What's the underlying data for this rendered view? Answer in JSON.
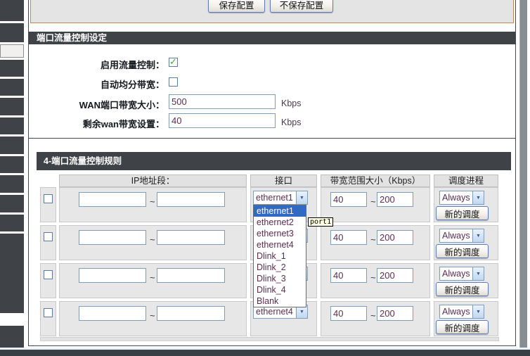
{
  "header": {
    "save_button": "保存配置",
    "discard_button": "不保存配置"
  },
  "settings": {
    "title": "端口流量控制设定",
    "enable_label": "启用流量控制：",
    "auto_split_label": "自动均分带宽：",
    "wan_bandwidth_label": "WAN端口带宽大小：",
    "wan_bandwidth_value": "500",
    "remain_bandwidth_label": "剩余wan带宽设置：",
    "remain_bandwidth_value": "40",
    "unit": "Kbps"
  },
  "rules": {
    "title": "4-端口流量控制规则",
    "col_ip": "IP地址段：",
    "col_iface": "接口",
    "col_bw": "带宽范围大小（Kbps）",
    "col_sched": "调度进程",
    "tilde": "~",
    "new_sched_label": "新的调度",
    "rows": [
      {
        "iface": "ethernet1",
        "bw_min": "40",
        "bw_max": "200",
        "sched": "Always"
      },
      {
        "iface": "",
        "bw_min": "40",
        "bw_max": "200",
        "sched": "Always"
      },
      {
        "iface": "",
        "bw_min": "40",
        "bw_max": "200",
        "sched": "Always"
      },
      {
        "iface": "ethernet4",
        "bw_min": "40",
        "bw_max": "200",
        "sched": "Always"
      }
    ],
    "dropdown_options": [
      "ethernet1",
      "ethernet2",
      "ethernet3",
      "ethernet4",
      "Dlink_1",
      "Dlink_2",
      "Dlink_3",
      "Dlink_4",
      "Blank"
    ],
    "dropdown_selected": "ethernet1",
    "tooltip": "port1"
  },
  "colors": {
    "bar_dark": "#3f4347",
    "selection_blue": "#316ac5",
    "tooltip_bg": "#ffffe1",
    "save_box_border": "#c4884a",
    "value_text": "#5b2d51"
  }
}
